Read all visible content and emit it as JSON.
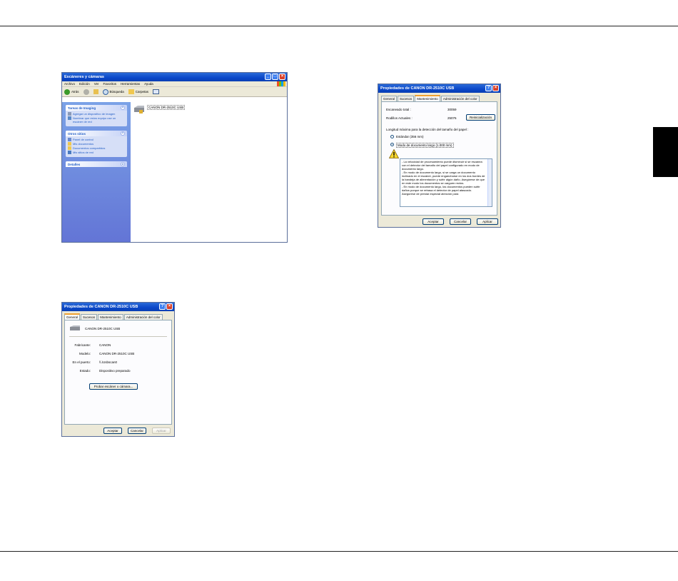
{
  "explorer": {
    "title": "Escáneres y cámaras",
    "menu": [
      "Archivo",
      "Edición",
      "Ver",
      "Favoritos",
      "Herramientas",
      "Ayuda"
    ],
    "toolbar": {
      "back": "Atrás",
      "search": "Búsqueda",
      "folders": "Carpetas"
    },
    "imaging_panel": {
      "title": "Tareas de Imaging",
      "items": [
        "Agregar un dispositivo de imagen",
        "Nombrar que estos equipo use un escáner de red"
      ]
    },
    "other_places_panel": {
      "title": "Otros sitios",
      "items": [
        "Panel de control",
        "Mis documentos",
        "Documentos compartidos",
        "Mis sitios de red"
      ]
    },
    "details_panel": {
      "title": "Detalles"
    },
    "device_label": "CANON DR-2510C USB"
  },
  "maintenance_dialog": {
    "title": "Propiedades de CANON DR-2510C USB",
    "tabs": [
      "General",
      "Sucesos",
      "Mantenimiento",
      "Administración del color"
    ],
    "total_scanned_label": "Escaneado total :",
    "total_scanned_value": "30059",
    "rollers_label": "Rodillos Actuales :",
    "rollers_value": "25076",
    "reset_button": "Reinicialización",
    "paper_length_label": "Longitud máxima para la detección del tamaño del papel :",
    "option_standard": "Estándar (356 mm)",
    "option_long": "Modo de documento largo (1.000 mm)",
    "warning_text": "- La velocidad de procesamiento puede disminuir si se escanea con el detector del tamaño del papel configurado en modo de documento largo.\n- En modo de documento largo, si se carga un documento inclinado en el escáner, puede engancharse en los dos bordes de la bandeja de alimentación y sufrir algún daño. Asegúrese de que en este modo los documentos se carguen rectos.\n- En modo de documento largo, los documentos pueden sufrir daños porque se retrasa el detector de papel atascado. Asegúrese de prestar especial atención para",
    "ok": "Aceptar",
    "cancel": "Cancelar",
    "apply": "Aplicar"
  },
  "general_dialog": {
    "title": "Propiedades de CANON DR-2510C USB",
    "tabs": [
      "General",
      "Sucesos",
      "Mantenimiento",
      "Administración del color"
    ],
    "device_name": "CANON DR-2510C USB",
    "manufacturer_label": "Fabricante:",
    "manufacturer_value": "CANON",
    "model_label": "Modelo:",
    "model_value": "CANON DR-2510C USB",
    "port_label": "En el puerto:",
    "port_value": "\\\\.\\Usbscan0",
    "status_label": "Estado:",
    "status_value": "Dispositivo preparado",
    "test_button": "Probar escáner o cámara...",
    "ok": "Aceptar",
    "cancel": "Cancelar",
    "apply": "Aplicar"
  }
}
